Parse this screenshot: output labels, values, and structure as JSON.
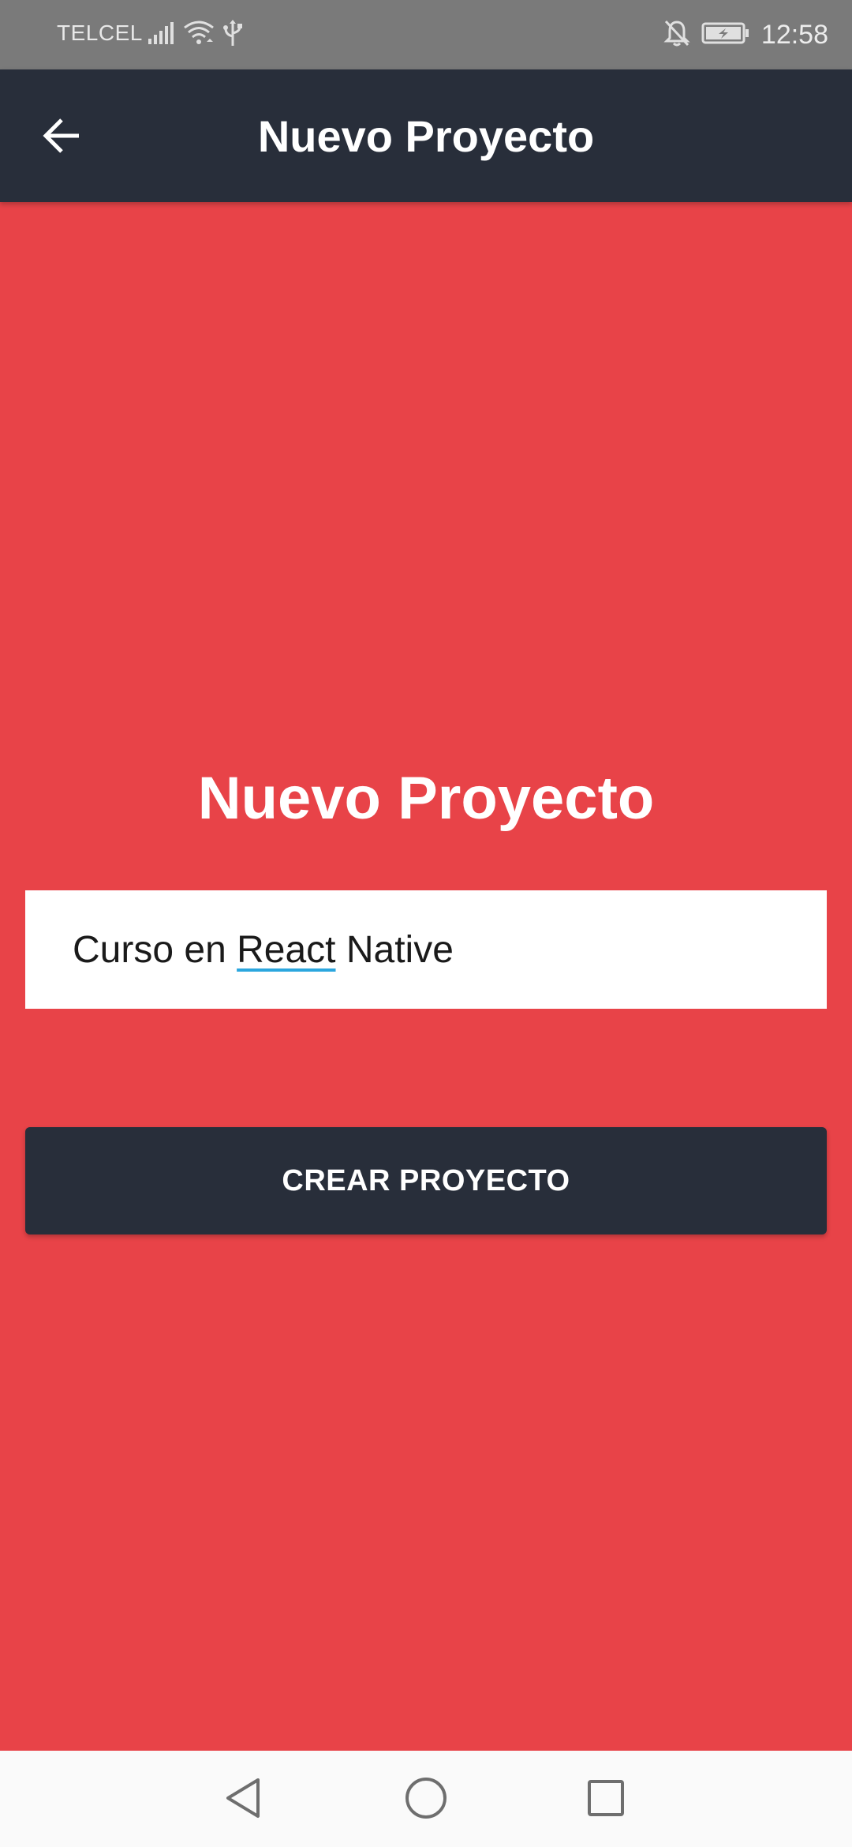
{
  "status_bar": {
    "carrier": "TELCEL",
    "time": "12:58",
    "icons": [
      "signal-icon",
      "wifi-icon",
      "usb-icon",
      "notifications-off-icon",
      "battery-charging-icon"
    ]
  },
  "app_bar": {
    "title": "Nuevo Proyecto",
    "back_icon": "arrow-back-icon"
  },
  "main": {
    "heading": "Nuevo Proyecto",
    "input": {
      "value_before": "Curso en ",
      "value_underlined": "React",
      "value_after": " Native"
    },
    "create_button_label": "CREAR PROYECTO"
  },
  "nav_bar": {
    "icons": [
      "back-triangle-icon",
      "home-circle-icon",
      "recents-square-icon"
    ]
  },
  "colors": {
    "background": "#E84348",
    "app_bar": "#282E3A",
    "button": "#282E3A",
    "status_bar": "#7A7A7A",
    "spell_underline": "#2BA6DE"
  }
}
